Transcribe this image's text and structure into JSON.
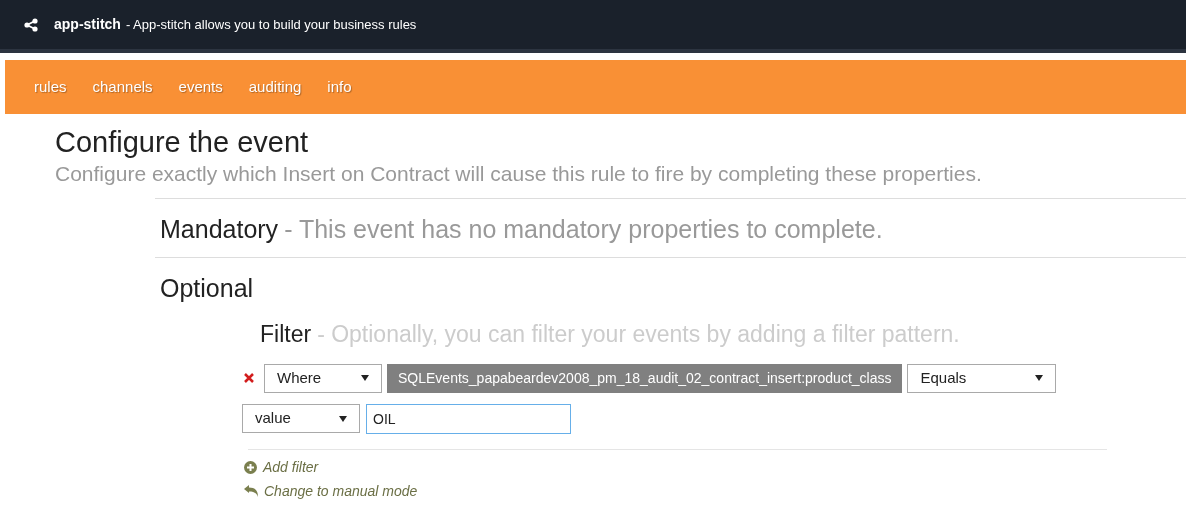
{
  "header": {
    "app_name": "app-stitch",
    "tagline": "- App-stitch allows you to build your business rules"
  },
  "nav": [
    {
      "label": "rules"
    },
    {
      "label": "channels"
    },
    {
      "label": "events"
    },
    {
      "label": "auditing"
    },
    {
      "label": "info"
    }
  ],
  "page": {
    "title": "Configure the event",
    "subtitle": "Configure exactly which Insert on Contract will cause this rule to fire by completing these properties."
  },
  "mandatory": {
    "title": "Mandatory",
    "note": "- This event has no mandatory properties to complete."
  },
  "optional": {
    "title": "Optional"
  },
  "filter": {
    "title": "Filter",
    "note": "- Optionally, you can filter your events by adding a filter pattern.",
    "condition": {
      "clause": "Where",
      "field": "SQLEvents_papabeardev2008_pm_18_audit_02_contract_insert:product_class",
      "operator": "Equals",
      "value_type": "value",
      "value": "OIL"
    },
    "actions": [
      {
        "kind": "add",
        "label": "Add filter"
      },
      {
        "kind": "manual",
        "label": "Change to manual mode"
      }
    ]
  }
}
